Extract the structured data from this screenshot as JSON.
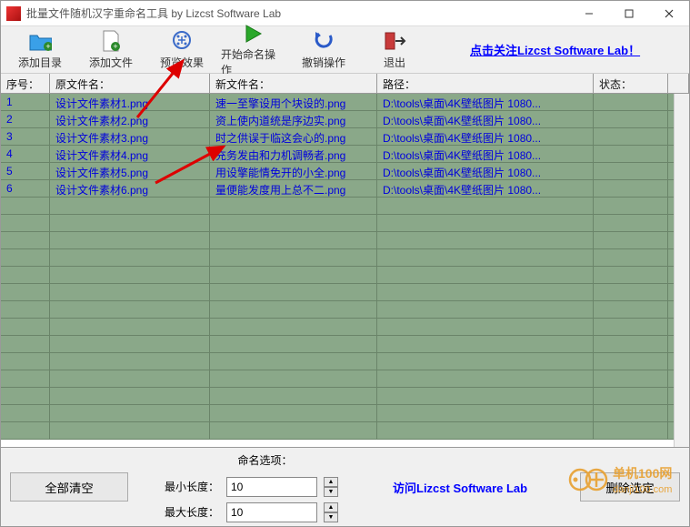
{
  "window": {
    "title": "批量文件随机汉字重命名工具    by Lizcst Software Lab"
  },
  "toolbar": {
    "add_dir": "添加目录",
    "add_file": "添加文件",
    "preview": "预览效果",
    "start": "开始命名操作",
    "undo": "撤销操作",
    "exit": "退出",
    "promo": "点击关注Lizcst Software Lab！"
  },
  "columns": {
    "idx": "序号：",
    "orig": "原文件名：",
    "newn": "新文件名：",
    "path": "路径：",
    "status": "状态："
  },
  "rows": [
    {
      "idx": "1",
      "orig": "设计文件素材1.png",
      "newn": "速一至擎设用个块设的.png",
      "path": "D:\\tools\\桌面\\4K壁纸图片 1080...",
      "status": ""
    },
    {
      "idx": "2",
      "orig": "设计文件素材2.png",
      "newn": "资上使内道统是序边实.png",
      "path": "D:\\tools\\桌面\\4K壁纸图片 1080...",
      "status": ""
    },
    {
      "idx": "3",
      "orig": "设计文件素材3.png",
      "newn": "时之供误于临这会心的.png",
      "path": "D:\\tools\\桌面\\4K壁纸图片 1080...",
      "status": ""
    },
    {
      "idx": "4",
      "orig": "设计文件素材4.png",
      "newn": "充务发由和力机调畅者.png",
      "path": "D:\\tools\\桌面\\4K壁纸图片 1080...",
      "status": ""
    },
    {
      "idx": "5",
      "orig": "设计文件素材5.png",
      "newn": "用设擎能情免开的小全.png",
      "path": "D:\\tools\\桌面\\4K壁纸图片 1080...",
      "status": ""
    },
    {
      "idx": "6",
      "orig": "设计文件素材6.png",
      "newn": "量便能发度用上总不二.png",
      "path": "D:\\tools\\桌面\\4K壁纸图片 1080...",
      "status": ""
    }
  ],
  "footer": {
    "clear_all": "全部清空",
    "opts_title": "命名选项：",
    "min_len_label": "最小长度：",
    "min_len_val": "10",
    "max_len_label": "最大长度：",
    "max_len_val": "10",
    "visit": "访问Lizcst Software Lab",
    "del_sel": "删除选定"
  },
  "watermark": {
    "brand": "单机100网",
    "url": "danji100.com"
  }
}
